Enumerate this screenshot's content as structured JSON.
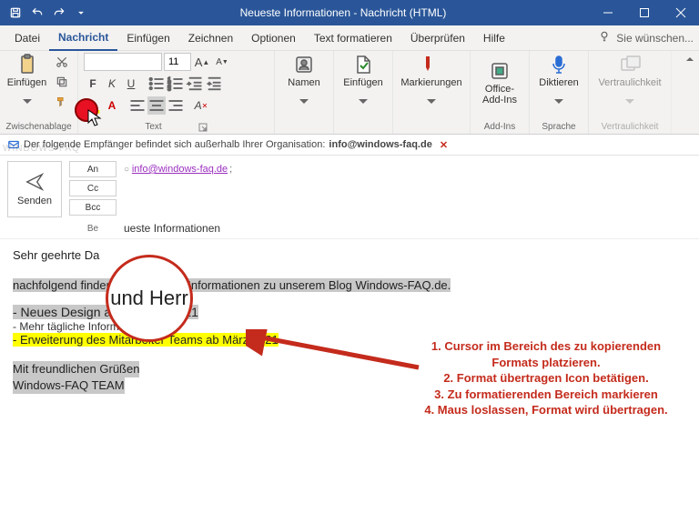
{
  "title": "Neueste Informationen   -   Nachricht (HTML)",
  "tabs": {
    "file": "Datei",
    "message": "Nachricht",
    "insert": "Einfügen",
    "draw": "Zeichnen",
    "options": "Optionen",
    "format": "Text formatieren",
    "review": "Überprüfen",
    "help": "Hilfe",
    "tellme": "Sie wünschen..."
  },
  "ribbon": {
    "clipboard": {
      "paste": "Einfügen",
      "label": "Zwischenablage"
    },
    "font": {
      "size": "11",
      "label": "Text"
    },
    "names": {
      "btn": "Namen"
    },
    "include": {
      "btn": "Einfügen"
    },
    "tags": {
      "btn": "Markierungen"
    },
    "addins": {
      "btn": "Office-\nAdd-Ins",
      "label": "Add-Ins"
    },
    "dictate": {
      "btn": "Diktieren",
      "label": "Sprache"
    },
    "sensitivity": {
      "btn": "Vertraulichkeit",
      "label": "Vertraulichkeit"
    }
  },
  "infotip": {
    "prefix": "Der folgende Empfänger befindet sich außerhalb Ihrer Organisation:",
    "email": "info@windows-faq.de"
  },
  "compose": {
    "send": "Senden",
    "to": "An",
    "cc": "Cc",
    "bcc": "Bcc",
    "subject_label": "Be",
    "subject_value": "ueste Informationen",
    "to_value": "info@windows-faq.de",
    "to_sep": ";"
  },
  "body": {
    "salutation": "Sehr geehrte Da",
    "magnified": "und Herr",
    "intro": "nachfolgend finden",
    "intro2": "sten Informationen zu unserem Blog Windows-FAQ.de.",
    "li1": "- Neues Design ab Februar 2021",
    "li2": "- Mehr tägliche Informationen",
    "li3": "- Erweiterung des Mitarbeiter Teams ab März 2021",
    "sign1": "Mit freundlichen Grüßen",
    "sign2": "Windows-FAQ TEAM"
  },
  "instructions": {
    "l1": "1. Cursor im Bereich des zu kopierenden Formats platzieren.",
    "l2": "2. Format übertragen Icon betätigen.",
    "l3": "3. Zu formatierenden Bereich markieren",
    "l4": "4. Maus loslassen, Format wird übertragen."
  },
  "watermark": "WINDOWS-FAQ"
}
